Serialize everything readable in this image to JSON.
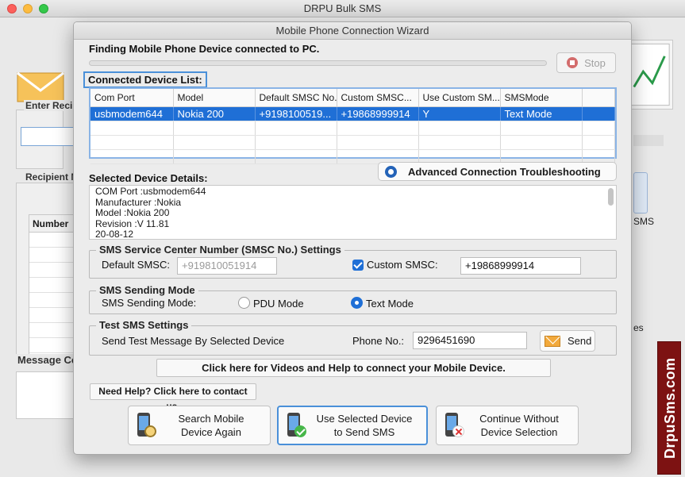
{
  "main_window": {
    "title": "DRPU Bulk SMS",
    "bg_labels": {
      "enter_recipient": "Enter Recipi",
      "recipient": "Recipient N",
      "number_col": "Number",
      "message": "Message Co",
      "right_sms": "SMS",
      "right_es": "es"
    },
    "brand_badge": "DrpuSms.com"
  },
  "dialog": {
    "title": "Mobile Phone Connection Wizard",
    "finding_text": "Finding Mobile Phone Device connected to PC.",
    "stop_label": "Stop",
    "connected_list_title": "Connected Device List:",
    "grid": {
      "columns": [
        "Com Port",
        "Model",
        "Default SMSC No.",
        "Custom SMSC...",
        "Use Custom SM...",
        "SMSMode"
      ],
      "rows": [
        [
          "usbmodem644",
          "Nokia 200",
          "+9198100519...",
          "+19868999914",
          "Y",
          "Text Mode"
        ]
      ]
    },
    "selected_details_title": "Selected Device Details:",
    "advanced_label": "Advanced Connection Troubleshooting",
    "details_lines": [
      "COM Port :usbmodem644",
      "Manufacturer :Nokia",
      "Model :Nokia 200",
      "Revision :V 11.81",
      "20-08-12"
    ],
    "smsc": {
      "legend": "SMS Service Center Number (SMSC No.) Settings",
      "default_label": "Default SMSC:",
      "default_value": "+919810051914",
      "custom_label": "Custom SMSC:",
      "custom_value": "+19868999914"
    },
    "sending_mode": {
      "legend": "SMS Sending Mode",
      "label": "SMS Sending Mode:",
      "pdu": "PDU Mode",
      "text": "Text Mode"
    },
    "test_sms": {
      "legend": "Test SMS Settings",
      "label": "Send Test Message By Selected Device",
      "phone_label": "Phone No.:",
      "phone_value": "9296451690",
      "send_label": "Send"
    },
    "videos_label": "Click here for Videos and Help to connect your Mobile Device.",
    "help_label": "Need Help? Click here to contact us.",
    "buttons": {
      "search": "Search Mobile\nDevice Again",
      "use_selected": "Use Selected Device\nto Send SMS",
      "continue": "Continue Without\nDevice Selection"
    }
  }
}
